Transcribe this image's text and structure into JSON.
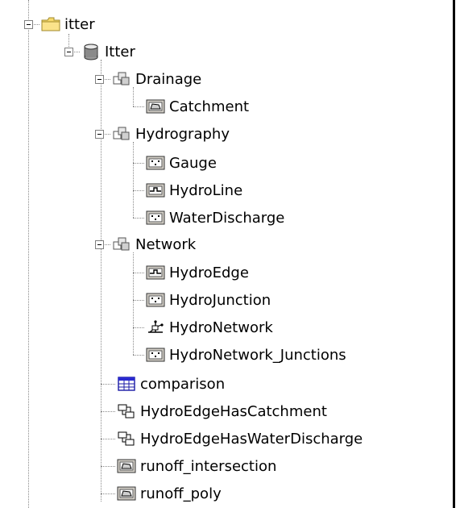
{
  "tree": {
    "root": {
      "label": "itter",
      "icon": "folder-icon"
    },
    "database": {
      "label": "Itter",
      "icon": "database-icon"
    },
    "datasets": [
      {
        "label": "Drainage",
        "icon": "feature-dataset-icon",
        "children": [
          {
            "label": "Catchment",
            "icon": "polygon-feature-class-icon"
          }
        ]
      },
      {
        "label": "Hydrography",
        "icon": "feature-dataset-icon",
        "children": [
          {
            "label": "Gauge",
            "icon": "point-feature-class-icon"
          },
          {
            "label": "HydroLine",
            "icon": "line-feature-class-icon"
          },
          {
            "label": "WaterDischarge",
            "icon": "point-feature-class-icon"
          }
        ]
      },
      {
        "label": "Network",
        "icon": "feature-dataset-icon",
        "children": [
          {
            "label": "HydroEdge",
            "icon": "line-feature-class-icon"
          },
          {
            "label": "HydroJunction",
            "icon": "point-feature-class-icon"
          },
          {
            "label": "HydroNetwork",
            "icon": "geometric-network-icon"
          },
          {
            "label": "HydroNetwork_Junctions",
            "icon": "point-feature-class-icon"
          }
        ]
      }
    ],
    "items": [
      {
        "label": "comparison",
        "icon": "table-icon"
      },
      {
        "label": "HydroEdgeHasCatchment",
        "icon": "relationship-class-icon"
      },
      {
        "label": "HydroEdgeHasWaterDischarge",
        "icon": "relationship-class-icon"
      },
      {
        "label": "runoff_intersection",
        "icon": "polygon-feature-class-icon"
      },
      {
        "label": "runoff_poly",
        "icon": "polygon-feature-class-icon"
      }
    ]
  }
}
